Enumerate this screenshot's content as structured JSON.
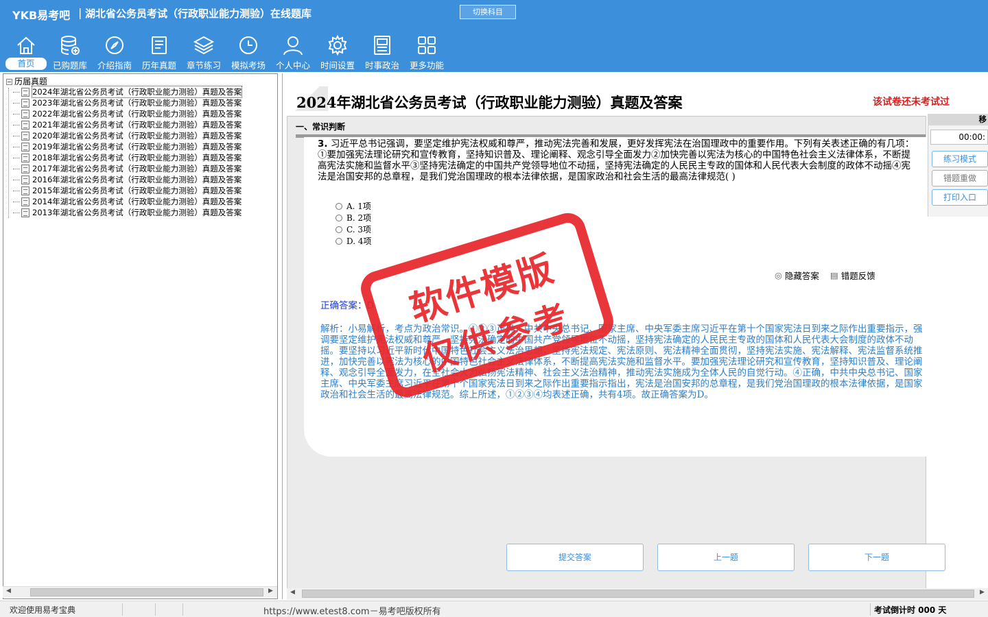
{
  "app": {
    "logo": "YKB易考吧",
    "title": "湖北省公务员考试（行政职业能力测验）在线题库",
    "switch_subject": "切换科目"
  },
  "nav": [
    {
      "label": "首页",
      "icon": "home-icon"
    },
    {
      "label": "已购题库",
      "icon": "database-icon"
    },
    {
      "label": "介绍指南",
      "icon": "compass-icon"
    },
    {
      "label": "历年真题",
      "icon": "list-doc-icon"
    },
    {
      "label": "章节练习",
      "icon": "layers-icon"
    },
    {
      "label": "模拟考场",
      "icon": "clock-icon"
    },
    {
      "label": "个人中心",
      "icon": "user-icon"
    },
    {
      "label": "时间设置",
      "icon": "gear-icon"
    },
    {
      "label": "时事政治",
      "icon": "news-icon"
    },
    {
      "label": "更多功能",
      "icon": "grid-icon"
    }
  ],
  "tree": {
    "root": "历届真题",
    "items": [
      "2024年湖北省公务员考试（行政职业能力测验）真题及答案",
      "2023年湖北省公务员考试（行政职业能力测验）真题及答案",
      "2022年湖北省公务员考试（行政职业能力测验）真题及答案",
      "2021年湖北省公务员考试（行政职业能力测验）真题及答案",
      "2020年湖北省公务员考试（行政职业能力测验）真题及答案",
      "2019年湖北省公务员考试（行政职业能力测验）真题及答案",
      "2018年湖北省公务员考试（行政职业能力测验）真题及答案",
      "2017年湖北省公务员考试（行政职业能力测验）真题及答案",
      "2016年湖北省公务员考试（行政职业能力测验）真题及答案",
      "2015年湖北省公务员考试（行政职业能力测验）真题及答案",
      "2014年湖北省公务员考试（行政职业能力测验）真题及答案",
      "2013年湖北省公务员考试（行政职业能力测验）真题及答案"
    ]
  },
  "exam": {
    "title": "2024年湖北省公务员考试（行政职业能力测验）真题及答案",
    "status": "该试卷还未考试过",
    "section": "一、常识判断",
    "question_number": "3.",
    "question_text": "习近平总书记强调，要坚定维护宪法权威和尊严，推动宪法完善和发展，更好发挥宪法在治国理政中的重要作用。下列有关表述正确的有几项：①要加强宪法理论研究和宣传教育，坚持知识普及、理论阐释、观念引导全面发力②加快完善以宪法为核心的中国特色社会主义法律体系，不断提高宪法实施和监督水平③坚持宪法确定的中国共产党领导地位不动摇，坚持宪法确定的人民民主专政的国体和人民代表大会制度的政体不动摇④宪法是治国安邦的总章程，是我们党治国理政的根本法律依据，是国家政治和社会生活的最高法律规范(  )",
    "options": [
      "A. 1项",
      "B. 2项",
      "C. 3项",
      "D. 4项"
    ],
    "hide_answer": "隐藏答案",
    "error_feedback": "错题反馈",
    "answer_label": "正确答案：",
    "answer_value": "D",
    "analysis": "解析：小易解析，考点为政治常识。①②③正确，中共中央总书记、国家主席、中央军委主席习近平在第十个国家宪法日到来之际作出重要指示，强调要坚定维护宪法权威和尊严，坚持宪法确定的中国共产党领导地位不动摇，坚持宪法确定的人民民主专政的国体和人民代表大会制度的政体不动摇。要坚持以习近平新时代中国特色社会主义法治思想，坚持宪法规定、宪法原则、宪法精神全面贯彻，坚持宪法实施、宪法解释、宪法监督系统推进，加快完善以宪法为核心的中国特色社会主义法律体系，不断提高宪法实施和监督水平。要加强宪法理论研究和宣传教育，坚持知识普及、理论阐释、观念引导全面发力，在全社会大力弘扬宪法精神、社会主义法治精神，推动宪法实施成为全体人民的自觉行动。④正确，中共中央总书记、国家主席、中央军委主席习近平在第十个国家宪法日到来之际作出重要指示指出，宪法是治国安邦的总章程，是我们党治国理政的根本法律依据，是国家政治和社会生活的最高法律规范。综上所述，①②③④均表述正确，共有4项。故正确答案为D。"
  },
  "side": {
    "title": "移",
    "timer": "00:00:",
    "practice_mode": "练习模式",
    "redo_wrong": "错题重做",
    "print": "打印入口"
  },
  "buttons": {
    "submit": "提交答案",
    "prev": "上一题",
    "next": "下一题"
  },
  "watermark": {
    "line1": "软件模版",
    "line2": "仅供参考"
  },
  "statusbar": {
    "welcome": "欢迎使用易考宝典",
    "url": "https://www.etest8.com－易考吧版权所有",
    "countdown": "考试倒计时 000 天"
  },
  "colors": {
    "brand": "#3b8fdb",
    "status_red": "#d82020",
    "answer_blue": "#1a3ad8",
    "analysis_blue": "#2f7fc9",
    "stamp_red": "#e8262a"
  }
}
